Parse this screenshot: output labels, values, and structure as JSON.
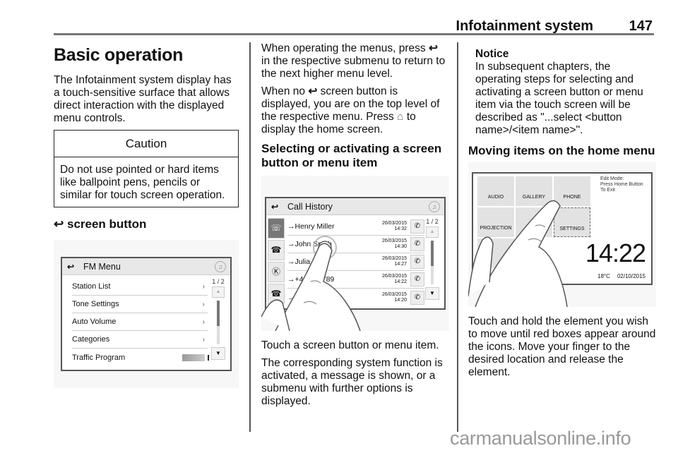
{
  "header": {
    "title": "Infotainment system",
    "page": "147"
  },
  "col1": {
    "heading": "Basic operation",
    "intro": "The Infotainment system display has a touch-sensitive surface that allows direct interaction with the displayed menu controls.",
    "caution": {
      "title": "Caution",
      "body": "Do not use pointed or hard items like ballpoint pens, pencils or similar for touch screen operation."
    },
    "subheading_glyph": "↩",
    "subheading": "screen button",
    "figure": {
      "back_icon": "back-arrow-icon",
      "title": "FM Menu",
      "items": [
        {
          "label": "Station List",
          "control": "chevron"
        },
        {
          "label": "Tone Settings",
          "control": "chevron"
        },
        {
          "label": "Auto Volume",
          "control": "chevron"
        },
        {
          "label": "Categories",
          "control": "chevron"
        },
        {
          "label": "Traffic Program",
          "control": "toggle"
        }
      ],
      "chevron": "›",
      "page": "1 / 2",
      "up": "▲",
      "down": "▼",
      "note_glyph": "♫"
    }
  },
  "col2": {
    "p1_a": "When operating the menus, press",
    "p1_glyph": "↩",
    "p1_b": "in the respective submenu to return to the next higher menu level.",
    "p2_a": "When no",
    "p2_glyph": "↩",
    "p2_b": "screen button is displayed, you are on the top level of the respective menu. Press",
    "p2_home": "⌂",
    "p2_c": "to display the home screen.",
    "heading": "Selecting or activating a screen button or menu item",
    "figure": {
      "title": "Call History",
      "calls": [
        {
          "name": "→Henry Miller",
          "date": "26/03/2015",
          "time": "14:32"
        },
        {
          "name": "→John Smith",
          "date": "26/03/2015",
          "time": "14:30"
        },
        {
          "name": "→Julia R...ff",
          "date": "26/03/2015",
          "time": "14:27"
        },
        {
          "name": "→+49...56789",
          "date": "26/03/2015",
          "time": "14:22"
        },
        {
          "name": "→+...567891",
          "date": "26/03/2015",
          "time": "14:20"
        }
      ],
      "side_tabs": [
        "☏",
        "☎",
        "Ⓚ",
        "☎"
      ],
      "call_glyph": "✆",
      "page": "1 / 2",
      "up": "▲",
      "down": "▼",
      "note_glyph": "♫"
    },
    "p3": "Touch a screen button or menu item.",
    "p4": "The corresponding system function is activated, a message is shown, or a submenu with further options is displayed."
  },
  "col3": {
    "notice": {
      "title": "Notice",
      "body": "In subsequent chapters, the operating steps for selecting and activating a screen button or menu item via the touch screen will be described as \"...select <button name>/<item name>\"."
    },
    "heading": "Moving items on the home menu",
    "figure": {
      "tiles": [
        "AUDIO",
        "GALLERY",
        "PHONE",
        "PROJECTION",
        "",
        "SETTINGS",
        ""
      ],
      "edit_mode": [
        "Edit Mode:",
        "Press Home Button",
        "To Exit"
      ],
      "clock": "14:22",
      "temp": "18°C",
      "date": "02/10/2015"
    },
    "p1": "Touch and hold the element you wish to move until red boxes appear around the icons. Move your finger to the desired location and release the element."
  },
  "watermark": "carmanualsonline.info"
}
